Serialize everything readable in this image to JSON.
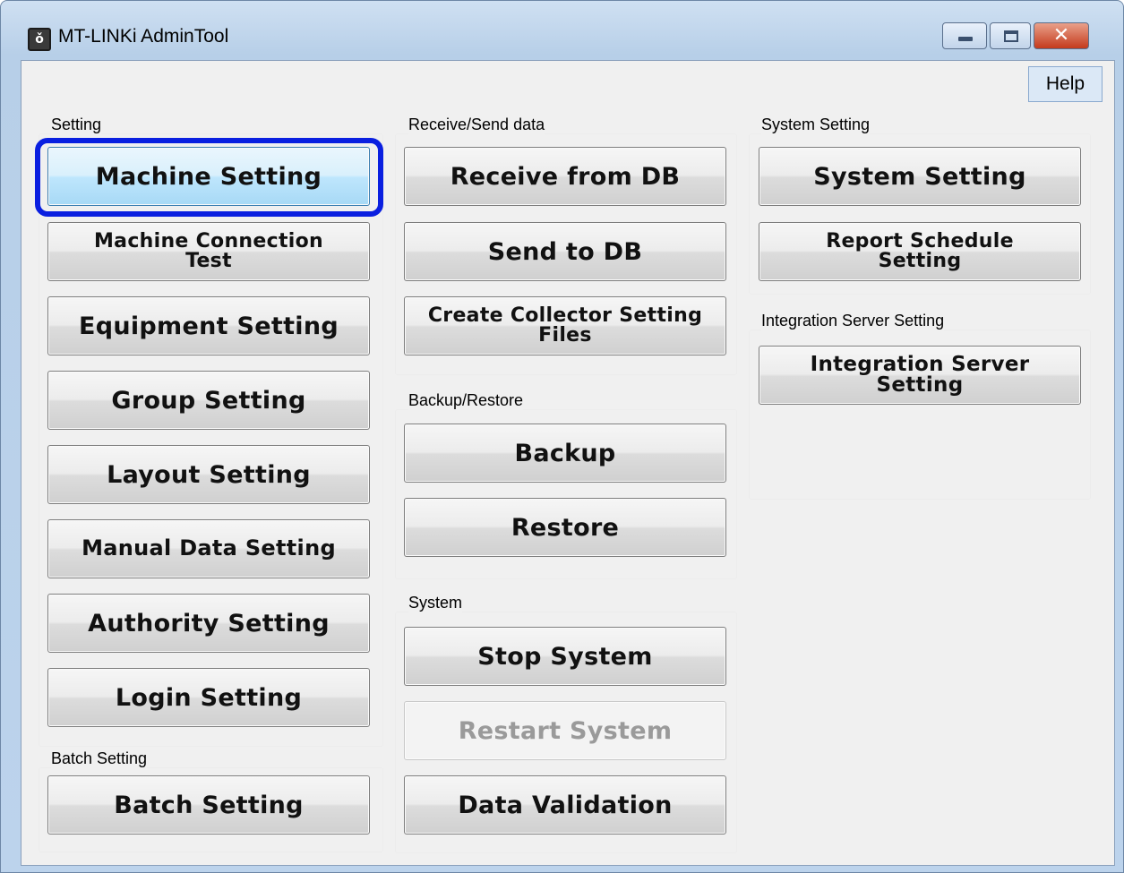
{
  "window": {
    "title": "MT-LINKi AdminTool",
    "icon": "app-logo-icon",
    "help_label": "Help",
    "close_glyph": "✕"
  },
  "groups": {
    "setting": "Setting",
    "receive_send": "Receive/Send data",
    "system_setting": "System Setting",
    "integration": "Integration Server Setting",
    "backup_restore": "Backup/Restore",
    "system": "System",
    "batch": "Batch Setting"
  },
  "buttons": {
    "machine_setting": "Machine Setting",
    "machine_connection_test": "Machine Connection Test",
    "equipment_setting": "Equipment Setting",
    "group_setting": "Group Setting",
    "layout_setting": "Layout Setting",
    "manual_data_setting": "Manual Data Setting",
    "authority_setting": "Authority Setting",
    "login_setting": "Login Setting",
    "batch_setting": "Batch Setting",
    "receive_from_db": "Receive from DB",
    "send_to_db": "Send to DB",
    "create_collector": "Create Collector Setting Files",
    "backup": "Backup",
    "restore": "Restore",
    "stop_system": "Stop System",
    "restart_system": "Restart System",
    "data_validation": "Data Validation",
    "system_setting": "System Setting",
    "report_schedule": "Report Schedule Setting",
    "integration_server": "Integration Server Setting"
  },
  "colors": {
    "focus_ring": "#0a1fe0",
    "disabled_text": "#9a9a9a"
  }
}
